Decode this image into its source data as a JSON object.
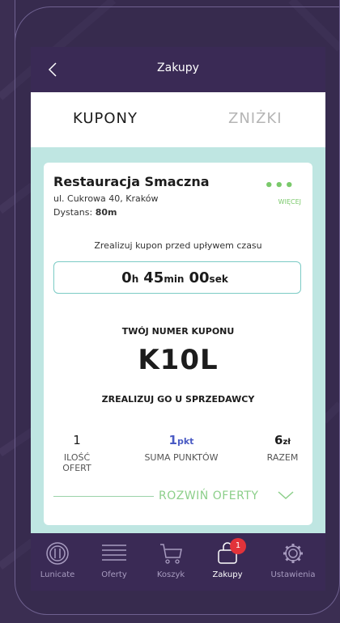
{
  "header": {
    "title": "Zakupy"
  },
  "tabs": [
    {
      "label": "KUPONY",
      "active": true
    },
    {
      "label": "ZNIŻKI",
      "active": false
    }
  ],
  "coupon": {
    "restaurant": "Restauracja Smaczna",
    "address": "ul. Cukrowa 40, Kraków",
    "distance_label": "Dystans:",
    "distance_value": "80m",
    "more_label": "WIĘCEJ",
    "instruction": "Zrealizuj kupon przed upływem czasu",
    "timer": {
      "h": "0",
      "h_unit": "h",
      "min": "45",
      "min_unit": "min",
      "sek": "00",
      "sek_unit": "sek"
    },
    "your_number_label": "TWÓJ NUMER KUPONU",
    "code": "K10L",
    "redeem_label": "ZREALIZUJ GO U SPRZEDAWCY",
    "stats": {
      "offers_value": "1",
      "offers_label": "ILOŚĆ OFERT",
      "points_value": "1",
      "points_unit": "pkt",
      "points_label": "SUMA PUNKTÓW",
      "total_value": "6",
      "total_unit": "zł",
      "total_label": "RAZEM"
    },
    "expand_label": "ROZWIŃ OFERTY"
  },
  "nav": [
    {
      "label": "Lunicate",
      "icon": "plate-icon"
    },
    {
      "label": "Oferty",
      "icon": "list-icon"
    },
    {
      "label": "Koszyk",
      "icon": "cart-icon"
    },
    {
      "label": "Zakupy",
      "icon": "bag-icon",
      "badge": "1",
      "active": true
    },
    {
      "label": "Ustawienia",
      "icon": "gear-icon"
    }
  ],
  "colors": {
    "primary": "#3a2a55",
    "accent_green": "#7ac96b",
    "teal": "#bfe6e2",
    "points_blue": "#4a5bc4",
    "badge_red": "#e2333a"
  }
}
